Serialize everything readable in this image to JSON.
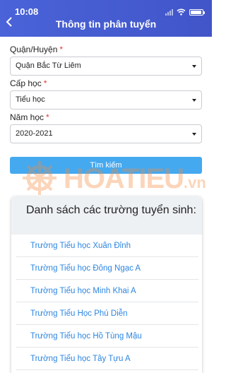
{
  "status_bar": {
    "time": "10:08"
  },
  "header": {
    "title": "Thông tin phân tuyển",
    "back_icon": "chevron-left-icon"
  },
  "form": {
    "district": {
      "label": "Quận/Huyện",
      "required_mark": "*",
      "value": "Quận Bắc Từ Liêm"
    },
    "level": {
      "label": "Cấp học",
      "required_mark": "*",
      "value": "Tiểu học"
    },
    "year": {
      "label": "Năm học",
      "required_mark": "*",
      "value": "2020-2021"
    },
    "search_label": "Tìm kiếm"
  },
  "watermark": {
    "brand": "HOATIEU",
    "suffix": ".vn"
  },
  "results": {
    "title": "Danh sách các trường tuyển sinh:",
    "schools": [
      "Trường Tiểu học Xuân Đỉnh",
      "Trường Tiểu học Đông Ngạc A",
      "Trường Tiểu học Minh Khai A",
      "Trường Tiểu Học Phú Diễn",
      "Trường Tiểu học Hồ Tùng Mậu",
      "Trường Tiểu học Tây Tựu A"
    ]
  },
  "colors": {
    "header": "#4a63d8",
    "button": "#45a9f0",
    "link": "#2d86e0",
    "required": "#e53935",
    "watermark": "#f58a3c"
  }
}
